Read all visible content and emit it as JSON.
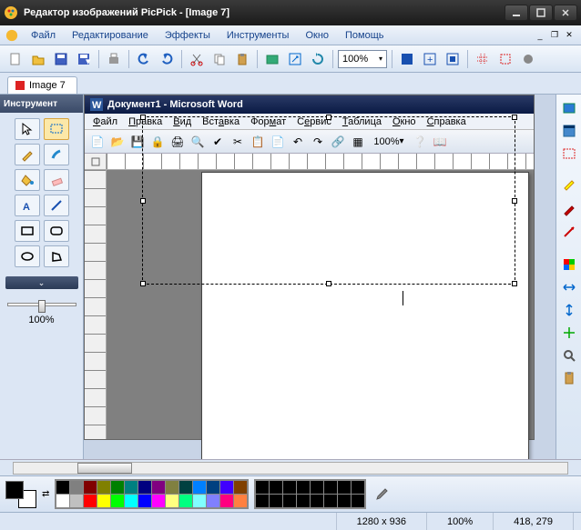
{
  "app": {
    "title": "Редактор изображений PicPick - [Image 7]"
  },
  "menubar": {
    "items": [
      "Файл",
      "Редактирование",
      "Эффекты",
      "Инструменты",
      "Окно",
      "Помощь"
    ]
  },
  "toolbar": {
    "zoom": "100%"
  },
  "tab": {
    "label": "Image 7"
  },
  "tools": {
    "header": "Инструмент",
    "zoom_label": "100%"
  },
  "word": {
    "title": "Документ1 - Microsoft Word",
    "menu": [
      "Файл",
      "Правка",
      "Вид",
      "Вставка",
      "Формат",
      "Сервис",
      "Таблица",
      "Окно",
      "Справка"
    ],
    "zoom": "100%"
  },
  "palette": {
    "colors_row1": [
      "#000000",
      "#808080",
      "#800000",
      "#808000",
      "#008000",
      "#008080",
      "#000080",
      "#800080",
      "#808040",
      "#004040",
      "#0080ff",
      "#004080",
      "#4000ff",
      "#804000"
    ],
    "colors_row2": [
      "#ffffff",
      "#c0c0c0",
      "#ff0000",
      "#ffff00",
      "#00ff00",
      "#00ffff",
      "#0000ff",
      "#ff00ff",
      "#ffff80",
      "#00ff80",
      "#80ffff",
      "#8080ff",
      "#ff0080",
      "#ff8040"
    ]
  },
  "status": {
    "dimensions": "1280 x 936",
    "zoom": "100%",
    "cursor": "418, 279"
  }
}
